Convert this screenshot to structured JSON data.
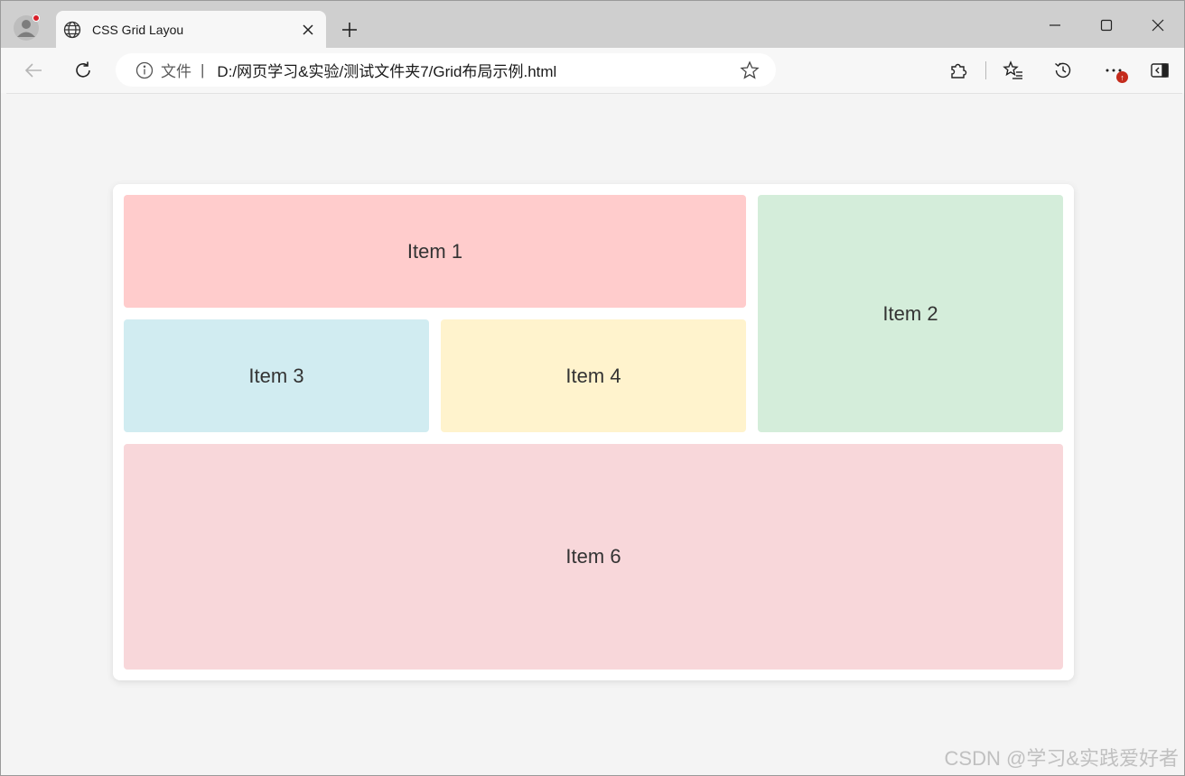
{
  "browser": {
    "tab_title": "CSS Grid Layou",
    "address_scheme_label": "文件",
    "address_separator": "|",
    "url": "D:/网页学习&实验/测试文件夹7/Grid布局示例.html",
    "menu_badge": "↑"
  },
  "icons": {
    "profile": "profile-avatar-icon",
    "tab_favicon": "globe-icon",
    "tab_close": "close-icon",
    "new_tab": "plus-icon",
    "minimize": "minimize-icon",
    "maximize": "maximize-icon",
    "close_window": "close-icon",
    "back": "back-arrow-icon",
    "refresh": "refresh-icon",
    "site_info": "info-icon",
    "favorite": "star-icon",
    "extensions": "puzzle-icon",
    "favorites": "favorites-list-icon",
    "history": "history-icon",
    "more": "more-icon",
    "sidebar": "sidebar-icon"
  },
  "page": {
    "items": [
      {
        "label": "Item 1",
        "color": "#ffcccc"
      },
      {
        "label": "Item 2",
        "color": "#d4edda"
      },
      {
        "label": "Item 3",
        "color": "#d1ecf1"
      },
      {
        "label": "Item 4",
        "color": "#fff3cd"
      },
      {
        "label": "Item 6",
        "color": "#f8d7da"
      }
    ]
  },
  "watermark": "CSDN @学习&实践爱好者"
}
